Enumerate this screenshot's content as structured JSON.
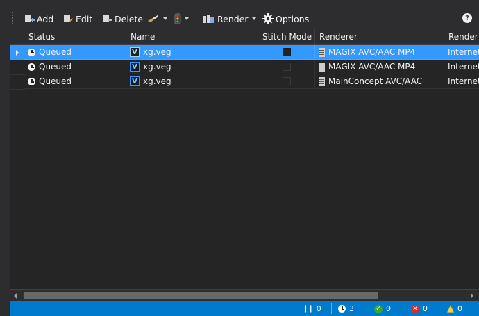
{
  "toolbar": {
    "add_label": "Add",
    "edit_label": "Edit",
    "delete_label": "Delete",
    "render_label": "Render",
    "options_label": "Options",
    "help_label": "?"
  },
  "grid": {
    "columns": [
      "Status",
      "Name",
      "Stitch Mode",
      "Renderer",
      "Render"
    ],
    "rows": [
      {
        "status": "Queued",
        "badge": "V",
        "name": "xg.veg",
        "stitch": false,
        "renderer": "MAGIX AVC/AAC MP4",
        "render": "Internet"
      },
      {
        "status": "Queued",
        "badge": "V",
        "name": "xg.veg",
        "stitch": false,
        "renderer": "MAGIX AVC/AAC MP4",
        "render": "Internet"
      },
      {
        "status": "Queued",
        "badge": "V",
        "name": "xg.veg",
        "stitch": false,
        "renderer": "MainConcept AVC/AAC",
        "render": "Internet"
      }
    ]
  },
  "statusbar": {
    "paused_count": "0",
    "queued_count": "3",
    "done_count": "0",
    "failed_count": "0",
    "warning_count": "0"
  },
  "colors": {
    "accent": "#007acc",
    "selection": "#3399ff",
    "background": "#252526"
  }
}
